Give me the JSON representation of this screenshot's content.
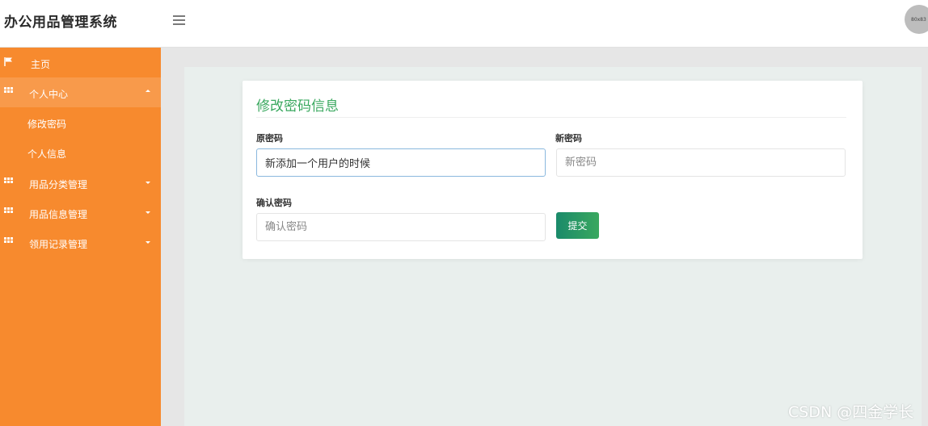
{
  "header": {
    "title": "办公用品管理系统",
    "avatar_text": "80x83"
  },
  "sidebar": {
    "items": [
      {
        "label": "主页",
        "icon": "flag-icon"
      },
      {
        "label": "个人中心",
        "icon": "grid-icon",
        "expanded": true
      },
      {
        "label": "修改密码",
        "sub": true
      },
      {
        "label": "个人信息",
        "sub": true
      },
      {
        "label": "用品分类管理",
        "icon": "grid-icon"
      },
      {
        "label": "用品信息管理",
        "icon": "grid-icon"
      },
      {
        "label": "领用记录管理",
        "icon": "grid-icon"
      }
    ]
  },
  "form": {
    "title": "修改密码信息",
    "old_password_label": "原密码",
    "old_password_value": "新添加一个用户的时候",
    "new_password_label": "新密码",
    "new_password_placeholder": "新密码",
    "confirm_label": "确认密码",
    "confirm_placeholder": "确认密码",
    "submit_label": "提交"
  },
  "watermark": "CSDN @四金学长",
  "colors": {
    "sidebar": "#f78a2e",
    "accent": "#3aa85f",
    "button": "#1a8a6a"
  }
}
